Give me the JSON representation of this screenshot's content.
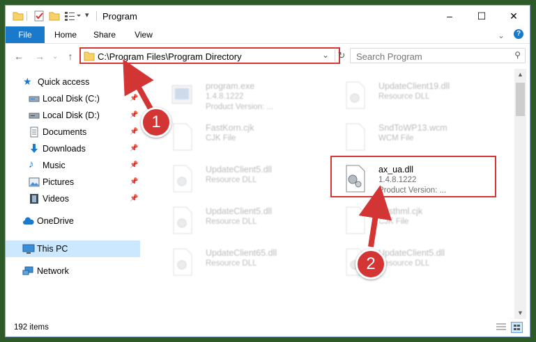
{
  "window": {
    "title": "Program",
    "controls": {
      "minimize": "–",
      "maximize": "☐",
      "close": "✕"
    }
  },
  "ribbon": {
    "tabs": [
      "File",
      "Home",
      "Share",
      "View"
    ],
    "help": "?"
  },
  "address": {
    "path": "C:\\Program Files\\Program Directory",
    "search_placeholder": "Search Program"
  },
  "sidebar": {
    "items": [
      {
        "label": "Quick access",
        "icon": "star-icon",
        "pinned": false
      },
      {
        "label": "Local Disk (C:)",
        "icon": "drive-icon",
        "pinned": true
      },
      {
        "label": "Local Disk (D:)",
        "icon": "drive-icon",
        "pinned": true
      },
      {
        "label": "Documents",
        "icon": "documents-icon",
        "pinned": true
      },
      {
        "label": "Downloads",
        "icon": "download-icon",
        "pinned": true
      },
      {
        "label": "Music",
        "icon": "music-icon",
        "pinned": true
      },
      {
        "label": "Pictures",
        "icon": "pictures-icon",
        "pinned": true
      },
      {
        "label": "Videos",
        "icon": "videos-icon",
        "pinned": true
      },
      {
        "label": "OneDrive",
        "icon": "cloud-icon",
        "pinned": false
      },
      {
        "label": "This PC",
        "icon": "pc-icon",
        "pinned": false,
        "selected": true
      },
      {
        "label": "Network",
        "icon": "network-icon",
        "pinned": false
      }
    ]
  },
  "files": [
    {
      "name": "program.exe",
      "line2": "1.4.8.1222",
      "line3": "Product Version: ...",
      "icon": "exe-icon",
      "highlighted": false
    },
    {
      "name": "UpdateClient19.dll",
      "line2": "Resource DLL",
      "line3": "",
      "icon": "dll-icon",
      "highlighted": false
    },
    {
      "name": "FastKorn.cjk",
      "line2": "CJK File",
      "line3": "",
      "icon": "file-icon",
      "highlighted": false
    },
    {
      "name": "SndToWP13.wcm",
      "line2": "WCM File",
      "line3": "",
      "icon": "file-icon",
      "highlighted": false
    },
    {
      "name": "UpdateClient5.dll",
      "line2": "Resource DLL",
      "line3": "",
      "icon": "dll-icon",
      "highlighted": false
    },
    {
      "name": "ax_ua.dll",
      "line2": "1.4.8.1222",
      "line3": "Product Version:      ...",
      "icon": "dll-icon",
      "highlighted": true
    },
    {
      "name": "UpdateClient5.dll",
      "line2": "Resource DLL",
      "line3": "",
      "icon": "dll-icon",
      "highlighted": false
    },
    {
      "name": "Fasthml.cjk",
      "line2": "CJK File",
      "line3": "",
      "icon": "file-icon",
      "highlighted": false
    },
    {
      "name": "UpdateClient65.dll",
      "line2": "Resource DLL",
      "line3": "",
      "icon": "dll-icon",
      "highlighted": false
    },
    {
      "name": "UpdateClient5.dll",
      "line2": "Resource DLL",
      "line3": "",
      "icon": "dll-icon",
      "highlighted": false
    }
  ],
  "status": {
    "item_count": "192 items"
  },
  "annotations": [
    {
      "number": "1"
    },
    {
      "number": "2"
    }
  ],
  "colors": {
    "accent": "#1979ca",
    "annotation": "#d33535",
    "selected": "#cce8ff"
  }
}
